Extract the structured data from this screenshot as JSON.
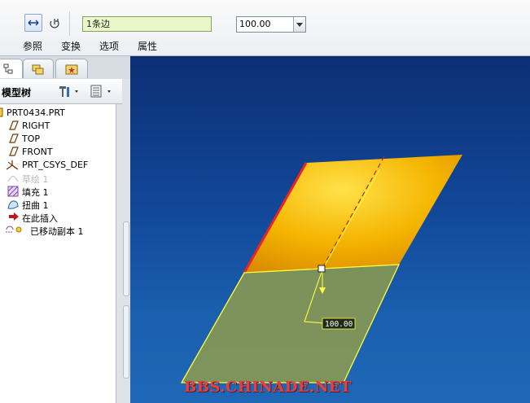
{
  "toolbar": {
    "reference_value": "1条边",
    "distance_value": "100.00",
    "tabs": [
      {
        "label": "参照"
      },
      {
        "label": "变换"
      },
      {
        "label": "选项"
      },
      {
        "label": "属性"
      }
    ]
  },
  "model_tree": {
    "title": "模型树",
    "items": [
      {
        "label": "PRT0434.PRT",
        "icon": "part-icon",
        "state": "normal"
      },
      {
        "label": "RIGHT",
        "icon": "datum-plane-icon",
        "state": "normal"
      },
      {
        "label": "TOP",
        "icon": "datum-plane-icon",
        "state": "normal"
      },
      {
        "label": "FRONT",
        "icon": "datum-plane-icon",
        "state": "normal"
      },
      {
        "label": "PRT_CSYS_DEF",
        "icon": "coordinate-system-icon",
        "state": "normal"
      },
      {
        "label": "草绘 1",
        "icon": "sketch-icon",
        "state": "suppressed"
      },
      {
        "label": "填充 1",
        "icon": "fill-icon",
        "state": "normal"
      },
      {
        "label": "扭曲 1",
        "icon": "warp-icon",
        "state": "normal"
      },
      {
        "label": "在此插入",
        "icon": "insert-here-arrow-icon",
        "state": "normal"
      },
      {
        "label": "已移动副本 1",
        "icon": "moved-copy-icon",
        "state": "normal"
      }
    ]
  },
  "viewport": {
    "dimension_label": "100.00",
    "colors": {
      "original_surface": "#f0a800",
      "moved_copy_surface": "#8a9a4a",
      "highlight_edge": "#e8232d",
      "preview_line": "#ffff00"
    }
  },
  "watermark": "BBS.CHINADE.NET"
}
